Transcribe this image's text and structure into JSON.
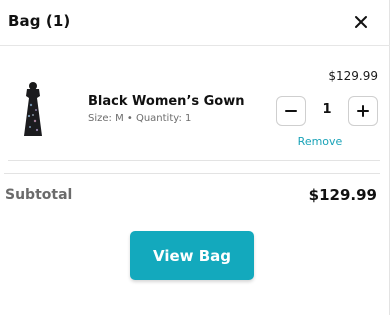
{
  "header": {
    "title": "Bag (1)",
    "close_icon": "close-icon"
  },
  "cart": {
    "item": {
      "name": "Black Women’s Gown",
      "meta": "Size: M • Quantity: 1",
      "price": "$129.99",
      "quantity": "1",
      "remove_label": "Remove",
      "image_icon": "black-gown-image"
    }
  },
  "summary": {
    "subtotal_label": "Subtotal",
    "subtotal_value": "$129.99"
  },
  "actions": {
    "view_bag_label": "View Bag"
  },
  "colors": {
    "accent": "#13a9bd",
    "text": "#111111",
    "muted": "#6b6b6b",
    "border": "#e3e3e3"
  }
}
